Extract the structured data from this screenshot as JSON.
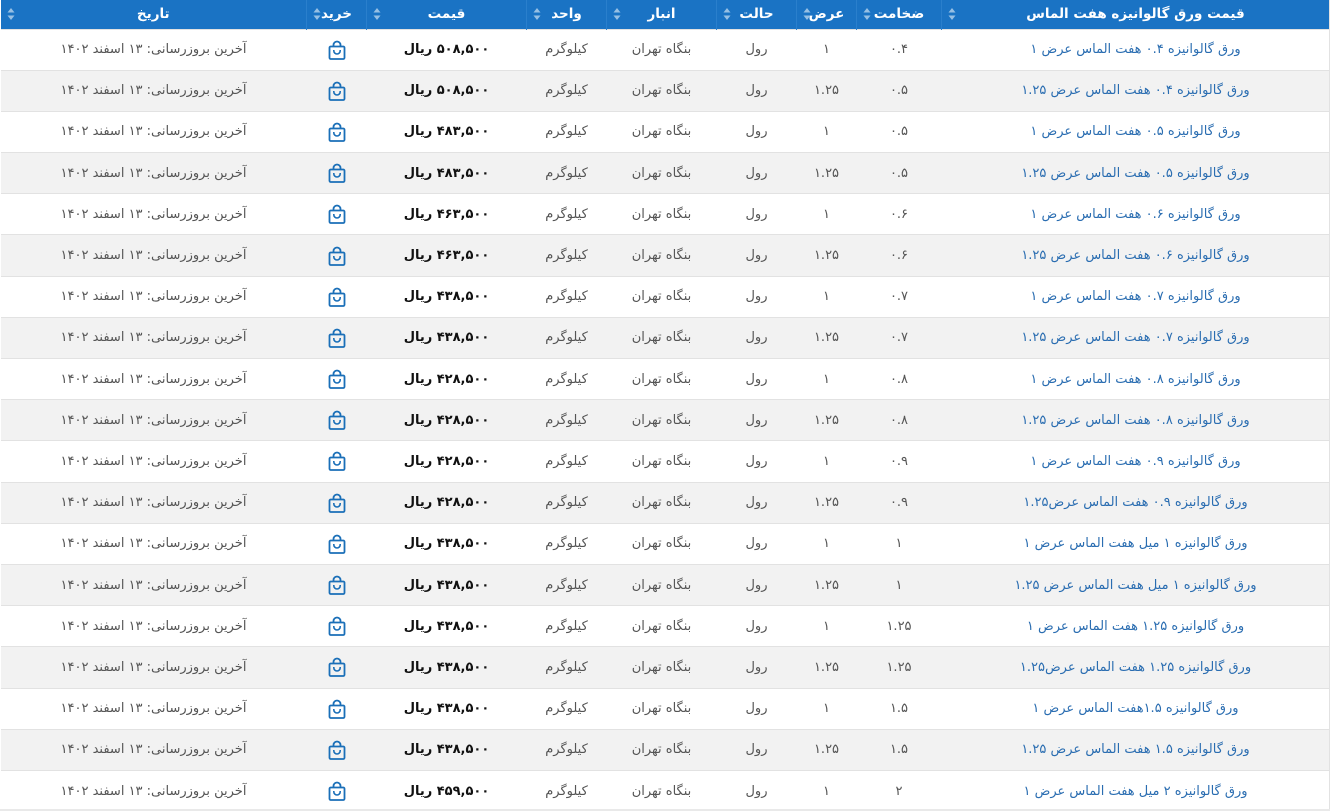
{
  "header": {
    "title": "قیمت ورق گالوانیزه هفت الماس",
    "thickness": "ضخامت",
    "width": "عرض",
    "state": "حالت",
    "warehouse": "انبار",
    "unit": "واحد",
    "price": "قیمت",
    "buy": "خرید",
    "date": "تاریخ"
  },
  "icons": {
    "sort": "sort-arrows-icon",
    "buy": "shopping-bag-icon"
  },
  "colors": {
    "header_bg": "#1a73c4",
    "title_link": "#2a6db1",
    "stripe": "#f2f2f2"
  },
  "rows": [
    {
      "title": "ورق گالوانیزه ۰.۴ هفت الماس عرض ۱",
      "thickness": "۰.۴",
      "width": "۱",
      "state": "رول",
      "warehouse": "بنگاه تهران",
      "unit": "کیلوگرم",
      "price": "۵۰۸,۵۰۰ ریال",
      "date": "آخرین بروزرسانی: ۱۳ اسفند ۱۴۰۲"
    },
    {
      "title": "ورق گالوانیزه ۰.۴ هفت الماس عرض ۱.۲۵",
      "thickness": "۰.۵",
      "width": "۱.۲۵",
      "state": "رول",
      "warehouse": "بنگاه تهران",
      "unit": "کیلوگرم",
      "price": "۵۰۸,۵۰۰ ریال",
      "date": "آخرین بروزرسانی: ۱۳ اسفند ۱۴۰۲"
    },
    {
      "title": "ورق گالوانیزه ۰.۵ هفت الماس عرض ۱",
      "thickness": "۰.۵",
      "width": "۱",
      "state": "رول",
      "warehouse": "بنگاه تهران",
      "unit": "کیلوگرم",
      "price": "۴۸۳,۵۰۰ ریال",
      "date": "آخرین بروزرسانی: ۱۳ اسفند ۱۴۰۲"
    },
    {
      "title": "ورق گالوانیزه ۰.۵ هفت الماس عرض ۱.۲۵",
      "thickness": "۰.۵",
      "width": "۱.۲۵",
      "state": "رول",
      "warehouse": "بنگاه تهران",
      "unit": "کیلوگرم",
      "price": "۴۸۳,۵۰۰ ریال",
      "date": "آخرین بروزرسانی: ۱۳ اسفند ۱۴۰۲"
    },
    {
      "title": "ورق گالوانیزه ۰.۶ هفت الماس عرض ۱",
      "thickness": "۰.۶",
      "width": "۱",
      "state": "رول",
      "warehouse": "بنگاه تهران",
      "unit": "کیلوگرم",
      "price": "۴۶۳,۵۰۰ ریال",
      "date": "آخرین بروزرسانی: ۱۳ اسفند ۱۴۰۲"
    },
    {
      "title": "ورق گالوانیزه ۰.۶ هفت الماس عرض ۱.۲۵",
      "thickness": "۰.۶",
      "width": "۱.۲۵",
      "state": "رول",
      "warehouse": "بنگاه تهران",
      "unit": "کیلوگرم",
      "price": "۴۶۳,۵۰۰ ریال",
      "date": "آخرین بروزرسانی: ۱۳ اسفند ۱۴۰۲"
    },
    {
      "title": "ورق گالوانیزه ۰.۷ هفت الماس عرض ۱",
      "thickness": "۰.۷",
      "width": "۱",
      "state": "رول",
      "warehouse": "بنگاه تهران",
      "unit": "کیلوگرم",
      "price": "۴۳۸,۵۰۰ ریال",
      "date": "آخرین بروزرسانی: ۱۳ اسفند ۱۴۰۲"
    },
    {
      "title": "ورق گالوانیزه ۰.۷ هفت الماس عرض ۱.۲۵",
      "thickness": "۰.۷",
      "width": "۱.۲۵",
      "state": "رول",
      "warehouse": "بنگاه تهران",
      "unit": "کیلوگرم",
      "price": "۴۳۸,۵۰۰ ریال",
      "date": "آخرین بروزرسانی: ۱۳ اسفند ۱۴۰۲"
    },
    {
      "title": "ورق گالوانیزه ۰.۸ هفت الماس عرض ۱",
      "thickness": "۰.۸",
      "width": "۱",
      "state": "رول",
      "warehouse": "بنگاه تهران",
      "unit": "کیلوگرم",
      "price": "۴۲۸,۵۰۰ ریال",
      "date": "آخرین بروزرسانی: ۱۳ اسفند ۱۴۰۲"
    },
    {
      "title": "ورق گالوانیزه ۰.۸ هفت الماس عرض ۱.۲۵",
      "thickness": "۰.۸",
      "width": "۱.۲۵",
      "state": "رول",
      "warehouse": "بنگاه تهران",
      "unit": "کیلوگرم",
      "price": "۴۲۸,۵۰۰ ریال",
      "date": "آخرین بروزرسانی: ۱۳ اسفند ۱۴۰۲"
    },
    {
      "title": "ورق گالوانیزه ۰.۹ هفت الماس عرض ۱",
      "thickness": "۰.۹",
      "width": "۱",
      "state": "رول",
      "warehouse": "بنگاه تهران",
      "unit": "کیلوگرم",
      "price": "۴۲۸,۵۰۰ ریال",
      "date": "آخرین بروزرسانی: ۱۳ اسفند ۱۴۰۲"
    },
    {
      "title": "ورق گالوانیزه ۰.۹ هفت الماس عرض۱.۲۵",
      "thickness": "۰.۹",
      "width": "۱.۲۵",
      "state": "رول",
      "warehouse": "بنگاه تهران",
      "unit": "کیلوگرم",
      "price": "۴۲۸,۵۰۰ ریال",
      "date": "آخرین بروزرسانی: ۱۳ اسفند ۱۴۰۲"
    },
    {
      "title": "ورق گالوانیزه ۱ میل هفت الماس عرض ۱",
      "thickness": "۱",
      "width": "۱",
      "state": "رول",
      "warehouse": "بنگاه تهران",
      "unit": "کیلوگرم",
      "price": "۴۳۸,۵۰۰ ریال",
      "date": "آخرین بروزرسانی: ۱۳ اسفند ۱۴۰۲"
    },
    {
      "title": "ورق گالوانیزه ۱ میل هفت الماس عرض ۱.۲۵",
      "thickness": "۱",
      "width": "۱.۲۵",
      "state": "رول",
      "warehouse": "بنگاه تهران",
      "unit": "کیلوگرم",
      "price": "۴۳۸,۵۰۰ ریال",
      "date": "آخرین بروزرسانی: ۱۳ اسفند ۱۴۰۲"
    },
    {
      "title": "ورق گالوانیزه ۱.۲۵ هفت الماس عرض ۱",
      "thickness": "۱.۲۵",
      "width": "۱",
      "state": "رول",
      "warehouse": "بنگاه تهران",
      "unit": "کیلوگرم",
      "price": "۴۳۸,۵۰۰ ریال",
      "date": "آخرین بروزرسانی: ۱۳ اسفند ۱۴۰۲"
    },
    {
      "title": "ورق گالوانیزه ۱.۲۵ هفت الماس عرض۱.۲۵",
      "thickness": "۱.۲۵",
      "width": "۱.۲۵",
      "state": "رول",
      "warehouse": "بنگاه تهران",
      "unit": "کیلوگرم",
      "price": "۴۳۸,۵۰۰ ریال",
      "date": "آخرین بروزرسانی: ۱۳ اسفند ۱۴۰۲"
    },
    {
      "title": "ورق گالوانیزه ۱.۵هفت الماس عرض ۱",
      "thickness": "۱.۵",
      "width": "۱",
      "state": "رول",
      "warehouse": "بنگاه تهران",
      "unit": "کیلوگرم",
      "price": "۴۳۸,۵۰۰ ریال",
      "date": "آخرین بروزرسانی: ۱۳ اسفند ۱۴۰۲"
    },
    {
      "title": "ورق گالوانیزه ۱.۵ هفت الماس عرض ۱.۲۵",
      "thickness": "۱.۵",
      "width": "۱.۲۵",
      "state": "رول",
      "warehouse": "بنگاه تهران",
      "unit": "کیلوگرم",
      "price": "۴۳۸,۵۰۰ ریال",
      "date": "آخرین بروزرسانی: ۱۳ اسفند ۱۴۰۲"
    },
    {
      "title": "ورق گالوانیزه ۲ میل هفت الماس عرض ۱",
      "thickness": "۲",
      "width": "۱",
      "state": "رول",
      "warehouse": "بنگاه تهران",
      "unit": "کیلوگرم",
      "price": "۴۵۹,۵۰۰ ریال",
      "date": "آخرین بروزرسانی: ۱۳ اسفند ۱۴۰۲"
    }
  ]
}
